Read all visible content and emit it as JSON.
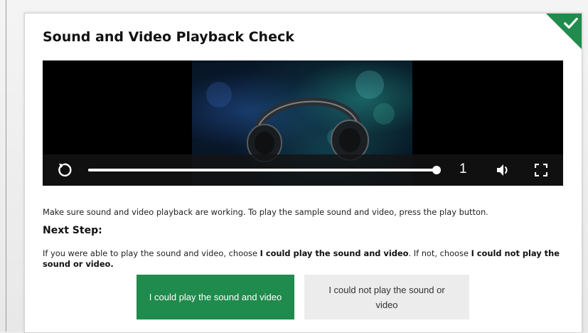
{
  "page": {
    "title": "Sound and Video Playback Check",
    "completed_badge_icon": "checkmark-icon",
    "accent_color": "#1f8b4c"
  },
  "player": {
    "replay_icon": "replay-icon",
    "progress_fraction": 1.0,
    "time_label": "1",
    "volume_icon": "volume-icon",
    "fullscreen_icon": "fullscreen-icon"
  },
  "content": {
    "instruction": "Make sure sound and video playback are working. To play the sample sound and video, press the play button.",
    "next_step_heading": "Next Step:",
    "choice_prefix": "If you were able to play the sound and video, choose ",
    "choice_yes_bold": "I could play the sound and video",
    "choice_middle": ". If not, choose ",
    "choice_no_bold": "I could not play the sound or video.",
    "choice_suffix": ""
  },
  "buttons": {
    "yes_label": "I could play the sound and video",
    "no_label": "I could not play the sound or video"
  }
}
